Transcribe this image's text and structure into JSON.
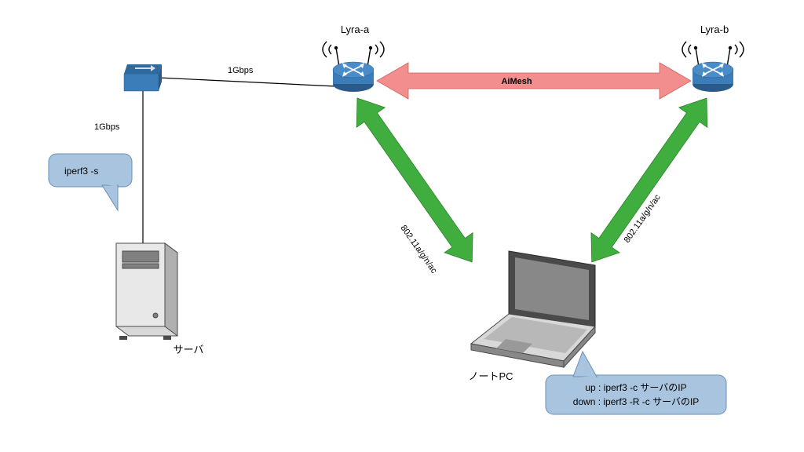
{
  "nodes": {
    "server": {
      "label": "サーバ"
    },
    "switch": {
      "label": ""
    },
    "router_a": {
      "label": "Lyra-a"
    },
    "router_b": {
      "label": "Lyra-b"
    },
    "laptop": {
      "label": "ノートPC"
    }
  },
  "links": {
    "switch_router_a": {
      "label": "1Gbps"
    },
    "switch_server": {
      "label": "1Gbps"
    },
    "mesh": {
      "label": "AiMesh"
    },
    "wifi_a": {
      "label": "802.11a/g/n/ac"
    },
    "wifi_b": {
      "label": "802.11a/g/n/ac"
    }
  },
  "callouts": {
    "server": {
      "text": "iperf3 -s"
    },
    "laptop": {
      "line1": "up : iperf3 -c サーバのIP",
      "line2": "down : iperf3 -R -c サーバのIP"
    }
  },
  "colors": {
    "device_blue": "#3b7db8",
    "device_blue_dark": "#2a5a8a",
    "arrow_green": "#3fae3f",
    "arrow_pink": "#f28e8e",
    "callout_fill": "#a9c4de",
    "callout_stroke": "#6890b8",
    "grey_dark": "#4a4a4a",
    "grey_mid": "#808080",
    "grey_light": "#d8d8d8"
  }
}
